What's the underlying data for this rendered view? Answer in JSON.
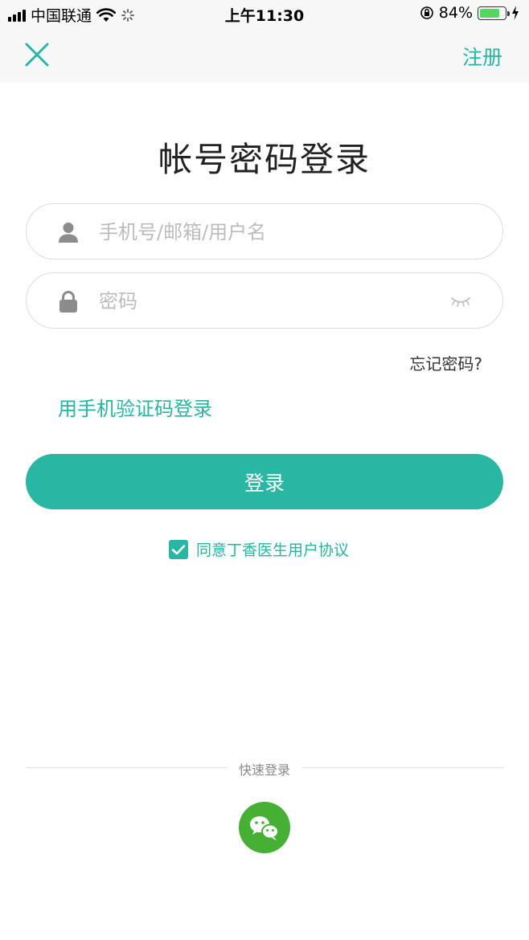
{
  "status_bar": {
    "carrier": "中国联通",
    "time": "上午11:30",
    "battery_percent": "84%",
    "battery_level": 0.84
  },
  "nav": {
    "register_label": "注册"
  },
  "page_title": "帐号密码登录",
  "form": {
    "account_placeholder": "手机号/邮箱/用户名",
    "password_placeholder": "密码"
  },
  "forgot_password": "忘记密码?",
  "sms_login": "用手机验证码登录",
  "login_button": "登录",
  "agreement": {
    "checked": true,
    "text": "同意丁香医生用户协议"
  },
  "quick_login": {
    "label": "快速登录",
    "providers": [
      "wechat-icon"
    ]
  },
  "colors": {
    "accent": "#29b6a3",
    "wechat": "#46b035",
    "battery": "#4cd964"
  }
}
